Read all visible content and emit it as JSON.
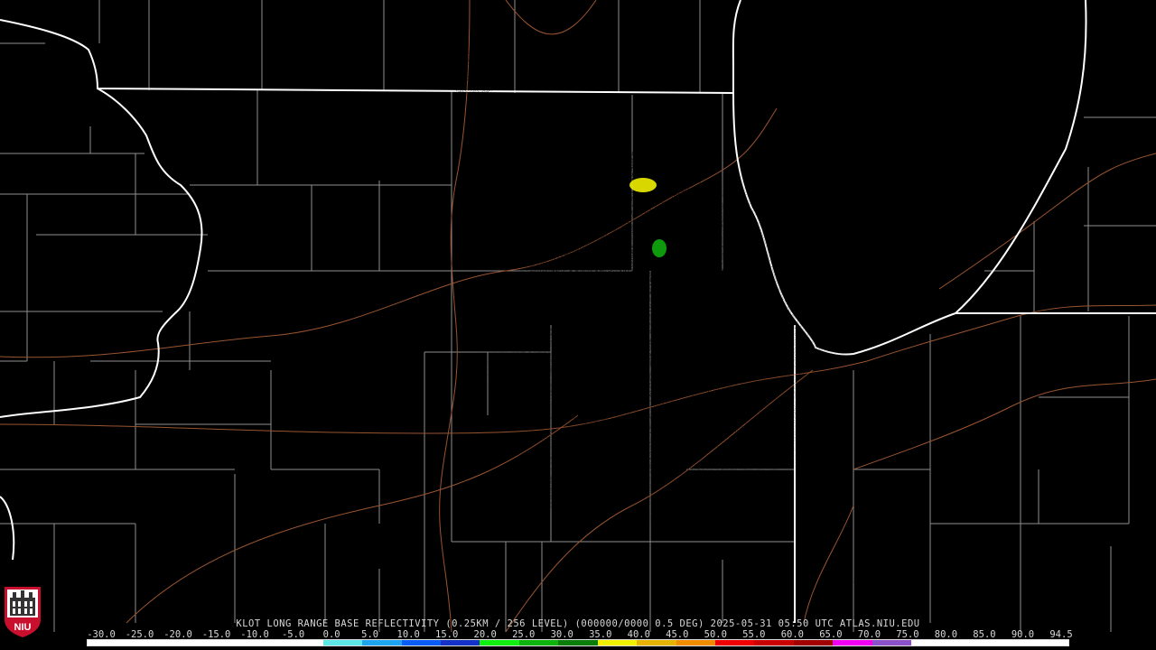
{
  "product": {
    "caption": "KLOT LONG RANGE BASE REFLECTIVITY (0.25KM / 256 LEVEL) (000000/0000 0.5 DEG) 2025-05-31 05:50 UTC  ATLAS.NIU.EDU"
  },
  "logo": {
    "text": "NIU",
    "color": "#c8102e"
  },
  "colorbar": {
    "ticks": [
      "-30.0",
      "-25.0",
      "-20.0",
      "-15.0",
      "-10.0",
      "-5.0",
      "0.0",
      "5.0",
      "10.0",
      "15.0",
      "20.0",
      "25.0",
      "30.0",
      "35.0",
      "40.0",
      "45.0",
      "50.0",
      "55.0",
      "60.0",
      "65.0",
      "70.0",
      "75.0",
      "80.0",
      "85.0",
      "90.0",
      "94.5"
    ],
    "colors": [
      "#ffffff",
      "#ffffff",
      "#ffffff",
      "#ffffff",
      "#ffffff",
      "#ffffff",
      "#5ee7e7",
      "#1fa4f0",
      "#0b5cf5",
      "#1432c8",
      "#10f010",
      "#0cb40c",
      "#0a7d0a",
      "#f0f000",
      "#e6b400",
      "#f08c00",
      "#f00000",
      "#c80000",
      "#a00000",
      "#f000f0",
      "#8c50c8",
      "#ffffff",
      "#ffffff",
      "#ffffff",
      "#ffffff"
    ]
  },
  "map": {
    "background": "#000000",
    "county_line_color": "#8f8f8f",
    "state_line_color": "#ffffff",
    "highway_color": "#9a5530"
  }
}
